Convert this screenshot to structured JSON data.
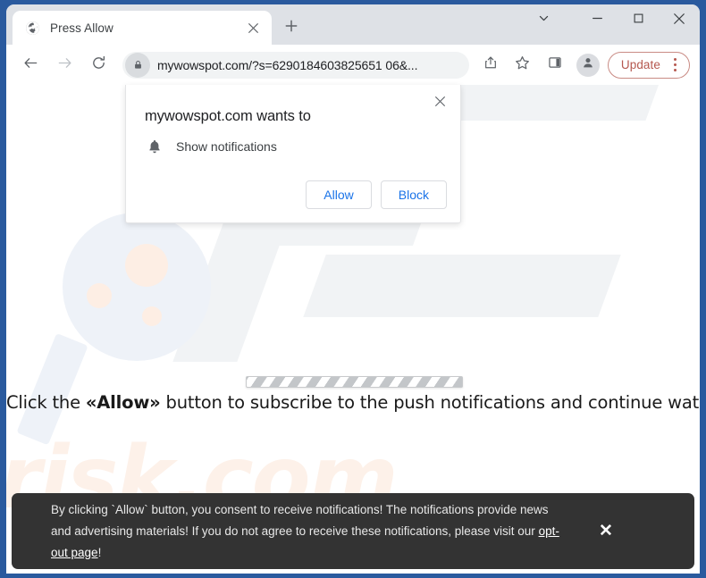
{
  "browser": {
    "tab": {
      "title": "Press Allow",
      "favicon_icon": "globe-icon",
      "close_icon": "close-icon"
    },
    "new_tab_icon": "plus-icon",
    "window_controls": {
      "tab_search_icon": "chevron-down-icon",
      "minimize_icon": "minimize-icon",
      "maximize_icon": "maximize-icon",
      "close_icon": "close-icon"
    },
    "toolbar": {
      "back_icon": "arrow-left-icon",
      "forward_icon": "arrow-right-icon",
      "reload_icon": "reload-icon",
      "lock_icon": "lock-icon",
      "url": "mywowspot.com/?s=6290184603825651 06&...",
      "share_icon": "share-icon",
      "bookmark_icon": "star-icon",
      "side_panel_icon": "side-panel-icon",
      "profile_icon": "avatar-icon",
      "update_label": "Update",
      "update_color": "#b5584f",
      "menu_icon": "kebab-menu-icon"
    }
  },
  "permission_dialog": {
    "title": "mywowspot.com wants to",
    "permission_icon": "bell-icon",
    "permission_label": "Show notifications",
    "allow_label": "Allow",
    "block_label": "Block",
    "close_icon": "close-icon",
    "link_color": "#1a73e8"
  },
  "page": {
    "headline_prefix": "Click the ",
    "headline_emphasis": "«Allow»",
    "headline_suffix": " button to subscribe to the push notifications and continue watching",
    "loading_bar_icon": "striped-progress-bar",
    "watermark_text": "risk.com",
    "watermark_color": "#fdf1e9"
  },
  "consent_banner": {
    "text_part1": "By clicking `Allow` button, you consent to receive notifications! The notifications provide news and advertising materials! If you do not agree to receive these notifications, please visit our ",
    "link_label": "opt-out page",
    "text_part2": "!",
    "close_icon": "close-icon",
    "background_color": "#333333"
  }
}
